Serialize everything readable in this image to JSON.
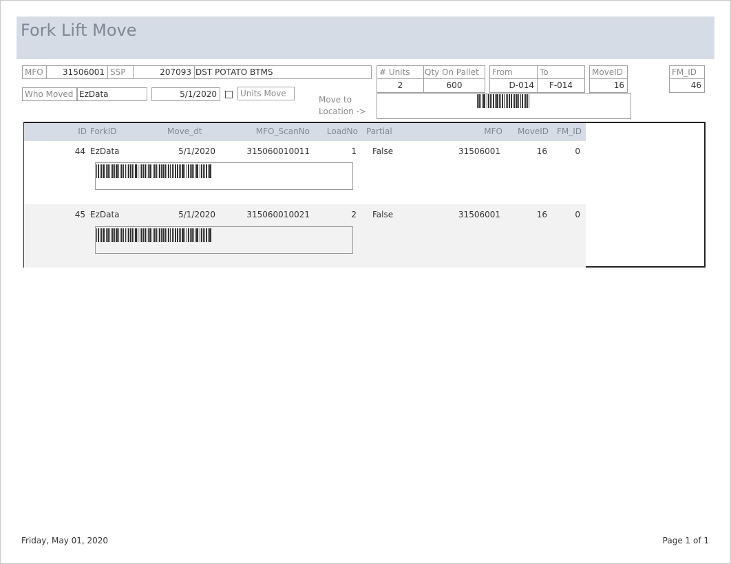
{
  "report": {
    "title": "Fork Lift Move"
  },
  "header": {
    "mfo_label": "MFO",
    "mfo_value": "31506001",
    "ssp_label": "SSP",
    "ssp_value": "207093",
    "ssp_desc": "DST POTATO BTMS",
    "who_moved_label": "Who Moved",
    "who_moved_value": "EzData",
    "date_value": "5/1/2020",
    "units_move_label": "Units Move",
    "units_move_checked": false,
    "move_to_label_1": "Move to",
    "move_to_label_2": "Location ->",
    "units_label": "# Units",
    "units_value": "2",
    "qty_label": "Qty On Pallet",
    "qty_value": "600",
    "from_label": "From",
    "from_value": "D-014",
    "to_label": "To",
    "to_value": "F-014",
    "moveid_label": "MoveID",
    "moveid_value": "16",
    "fmid_label": "FM_ID",
    "fmid_value": "46"
  },
  "table": {
    "columns": [
      "ID",
      "ForkID",
      "Move_dt",
      "MFO_ScanNo",
      "LoadNo",
      "Partial",
      "MFO",
      "MoveID",
      "FM_ID"
    ],
    "rows": [
      {
        "id": "44",
        "forkid": "EzData",
        "move_dt": "5/1/2020",
        "scan_no": "315060010011",
        "load_no": "1",
        "partial": "False",
        "mfo": "31506001",
        "moveid": "16",
        "fm_id": "0"
      },
      {
        "id": "45",
        "forkid": "EzData",
        "move_dt": "5/1/2020",
        "scan_no": "315060010021",
        "load_no": "2",
        "partial": "False",
        "mfo": "31506001",
        "moveid": "16",
        "fm_id": "0"
      }
    ]
  },
  "footer": {
    "date": "Friday, May 01, 2020",
    "page": "Page 1 of 1"
  },
  "colors": {
    "band": "#d5dce6",
    "alt_row": "#f2f2f2",
    "label": "#8a8a8a"
  }
}
